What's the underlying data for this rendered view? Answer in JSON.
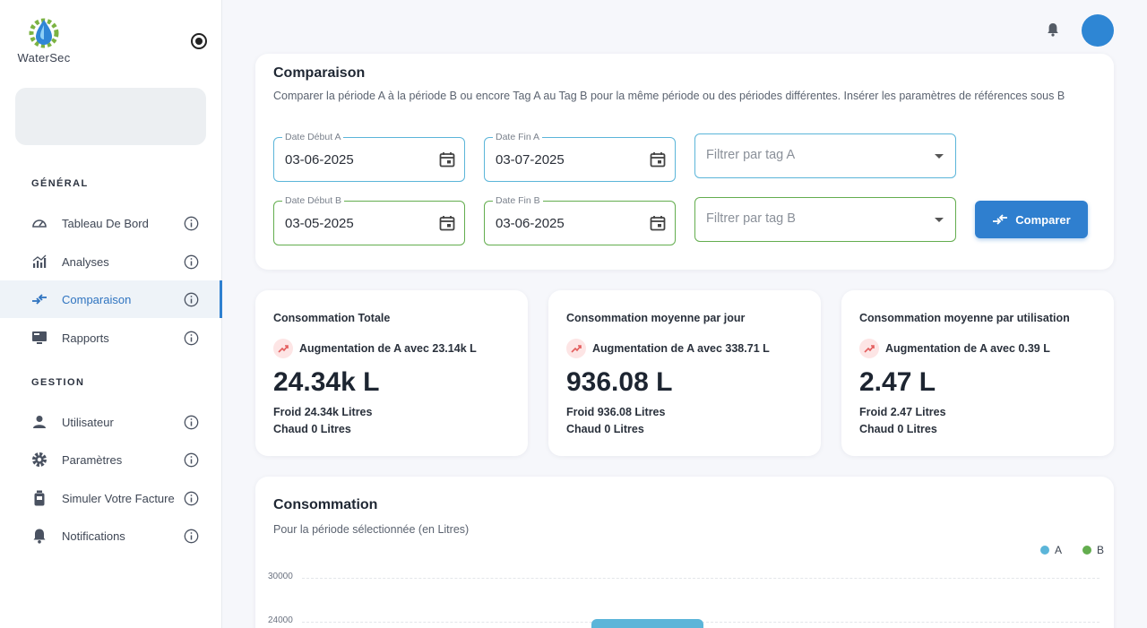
{
  "app": {
    "name": "WaterSec"
  },
  "colors": {
    "accent": "#2f7fcf",
    "series_a": "#5bb5d9",
    "series_b": "#63ad4e",
    "trend_up": "#e35d5d"
  },
  "sidebar": {
    "sections": [
      {
        "title": "GÉNÉRAL",
        "items": [
          {
            "label": "Tableau De Bord",
            "icon": "dashboard-gauge-icon",
            "active": false
          },
          {
            "label": "Analyses",
            "icon": "analytics-chart-icon",
            "active": false
          },
          {
            "label": "Comparaison",
            "icon": "compare-arrows-icon",
            "active": true
          },
          {
            "label": "Rapports",
            "icon": "monitor-report-icon",
            "active": false
          }
        ]
      },
      {
        "title": "GESTION",
        "items": [
          {
            "label": "Utilisateur",
            "icon": "user-icon",
            "active": false
          },
          {
            "label": "Paramètres",
            "icon": "gear-icon",
            "active": false
          },
          {
            "label": "Simuler Votre Facture",
            "icon": "meter-icon",
            "active": false
          },
          {
            "label": "Notifications",
            "icon": "bell-icon",
            "active": false
          }
        ]
      }
    ]
  },
  "comparison": {
    "title": "Comparaison",
    "description": "Comparer la période A à la période B ou encore Tag A au Tag B pour la même période ou des périodes différentes. Insérer les paramètres de références sous B",
    "start_a": {
      "label": "Date Début A",
      "value": "03-06-2025"
    },
    "end_a": {
      "label": "Date Fin A",
      "value": "03-07-2025"
    },
    "tag_a": {
      "placeholder": "Filtrer par tag A"
    },
    "start_b": {
      "label": "Date Début B",
      "value": "03-05-2025"
    },
    "end_b": {
      "label": "Date Fin B",
      "value": "03-06-2025"
    },
    "tag_b": {
      "placeholder": "Filtrer par tag B"
    },
    "button_label": "Comparer"
  },
  "stats": [
    {
      "title": "Consommation Totale",
      "trend": "Augmentation de A avec 23.14k L",
      "value": "24.34k L",
      "cold": "Froid 24.34k Litres",
      "hot": "Chaud 0 Litres"
    },
    {
      "title": "Consommation moyenne par jour",
      "trend": "Augmentation de A avec 338.71 L",
      "value": "936.08 L",
      "cold": "Froid 936.08 Litres",
      "hot": "Chaud 0 Litres"
    },
    {
      "title": "Consommation moyenne par utilisation",
      "trend": "Augmentation de A avec 0.39 L",
      "value": "2.47 L",
      "cold": "Froid 2.47 Litres",
      "hot": "Chaud 0 Litres"
    }
  ],
  "chart": {
    "title": "Consommation",
    "subtitle": "Pour la période sélectionnée (en Litres)",
    "legend": [
      {
        "name": "A",
        "color": "#5bb5d9"
      },
      {
        "name": "B",
        "color": "#63ad4e"
      }
    ],
    "y_ticks": [
      "30000",
      "24000"
    ]
  },
  "chart_data": {
    "type": "bar",
    "title": "Consommation",
    "subtitle": "Pour la période sélectionnée (en Litres)",
    "y_ticks": [
      30000,
      24000
    ],
    "series": [
      {
        "name": "A",
        "values": [
          24340
        ]
      },
      {
        "name": "B",
        "values": []
      }
    ],
    "grid": true,
    "legend": "top-right"
  }
}
